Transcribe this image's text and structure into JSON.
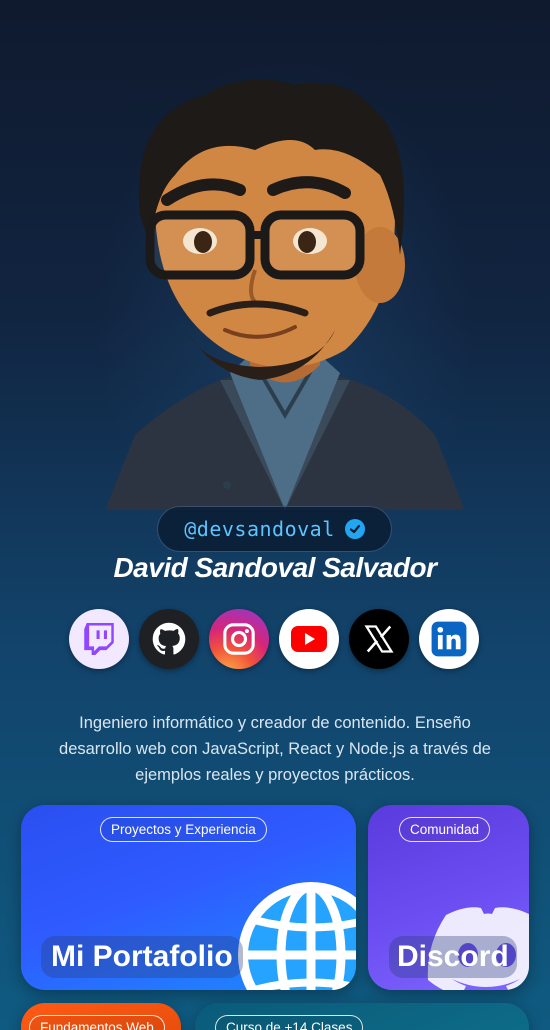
{
  "profile": {
    "handle": "@devsandoval",
    "name": "David Sandoval Salvador",
    "bio": "Ingeniero informático y creador de contenido. Enseño desarrollo web con JavaScript, React y Node.js a través de ejemplos reales y proyectos prácticos."
  },
  "socials": [
    {
      "name": "twitch",
      "icon": "twitch-icon",
      "color": "#9146ff"
    },
    {
      "name": "github",
      "icon": "github-icon",
      "color": "#ffffff"
    },
    {
      "name": "instagram",
      "icon": "instagram-icon",
      "color": "#ffffff"
    },
    {
      "name": "youtube",
      "icon": "youtube-icon",
      "color": "#ff0000"
    },
    {
      "name": "x",
      "icon": "x-icon",
      "color": "#ffffff"
    },
    {
      "name": "linkedin",
      "icon": "linkedin-icon",
      "color": "#0a66c2"
    }
  ],
  "cards": {
    "portfolio": {
      "tag": "Proyectos y Experiencia",
      "title": "Mi Portafolio",
      "icon": "globe-icon"
    },
    "discord": {
      "tag": "Comunidad",
      "title": "Discord",
      "icon": "discord-icon"
    },
    "fundamentos": {
      "tag": "Fundamentos Web"
    },
    "curso": {
      "tag": "Curso de +14 Clases"
    }
  },
  "colors": {
    "accent": "#5fc3ff",
    "verified": "#22a6f2"
  }
}
